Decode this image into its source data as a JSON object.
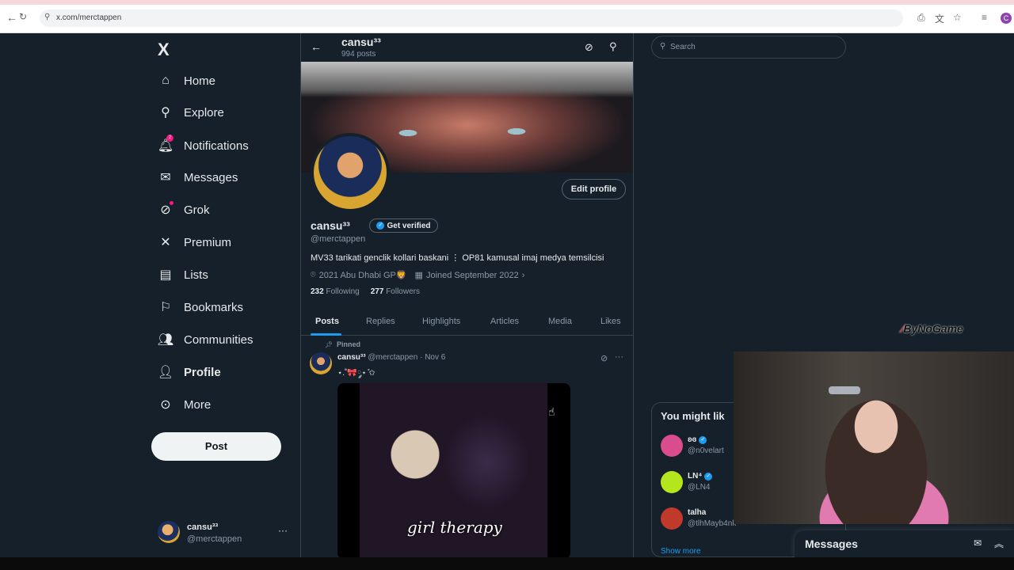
{
  "browser": {
    "url": "x.com/merctappen",
    "avatar_letter": "C"
  },
  "nav": {
    "logo": "X",
    "items": [
      {
        "label": "Home",
        "icon": "home-icon"
      },
      {
        "label": "Explore",
        "icon": "search-icon"
      },
      {
        "label": "Notifications",
        "icon": "bell-icon",
        "badge": "2"
      },
      {
        "label": "Messages",
        "icon": "envelope-icon"
      },
      {
        "label": "Grok",
        "icon": "grok-icon"
      },
      {
        "label": "Premium",
        "icon": "x-icon"
      },
      {
        "label": "Lists",
        "icon": "list-icon"
      },
      {
        "label": "Bookmarks",
        "icon": "bookmark-icon"
      },
      {
        "label": "Communities",
        "icon": "people-icon"
      },
      {
        "label": "Profile",
        "icon": "person-icon"
      },
      {
        "label": "More",
        "icon": "more-circle-icon"
      }
    ],
    "post_label": "Post",
    "account": {
      "name": "cansu³³",
      "handle": "@merctappen",
      "more": "···"
    }
  },
  "profile": {
    "top_name": "cansu³³",
    "post_count": "994 posts",
    "edit_label": "Edit profile",
    "name": "cansu³³",
    "verify_label": "Get verified",
    "handle": "@merctappen",
    "bio": "MV33 tarikati genclik kollari baskani ⋮ OP81 kamusal imaj medya temsilcisi",
    "location": "2021 Abu Dhabi GP🦁",
    "joined": "Joined September 2022",
    "following_count": "232",
    "following_label": "Following",
    "followers_count": "277",
    "followers_label": "Followers",
    "tabs": [
      "Posts",
      "Replies",
      "Highlights",
      "Articles",
      "Media",
      "Likes"
    ]
  },
  "post": {
    "pinned_label": "Pinned",
    "author": "cansu³³",
    "meta": "@merctappen · Nov 6",
    "text": "⋆.˚🎀༘⋆ ̊✩",
    "caption": "girl therapy"
  },
  "right": {
    "search_placeholder": "Search",
    "wtf_title": "You might lik",
    "suggestions": [
      {
        "name": "ʚɞ",
        "handle": "@n0velart",
        "color": "#d94d8f"
      },
      {
        "name": "LN⁴",
        "handle": "@LN4",
        "color": "#b5e61d"
      },
      {
        "name": "talha",
        "handle": "@tlhMayb4nk",
        "color": "#c0392b"
      }
    ],
    "show_more": "Show more",
    "messages_title": "Messages"
  },
  "overlay": {
    "watermark": "ByNoGame"
  }
}
